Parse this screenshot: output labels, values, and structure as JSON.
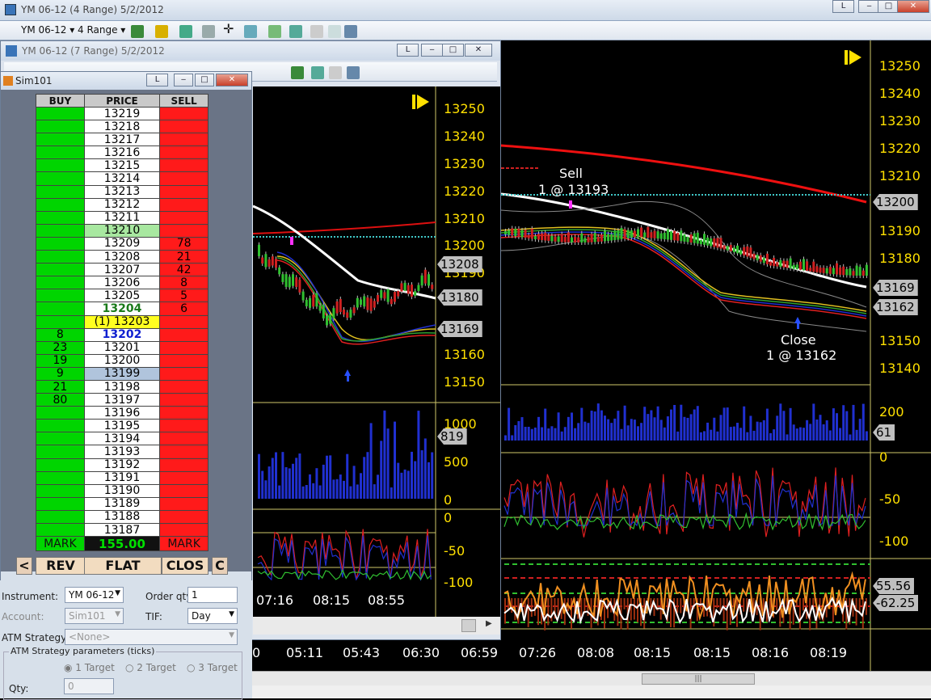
{
  "main_window": {
    "title": "YM 06-12 (4 Range)  5/2/2012",
    "l_btn": "L"
  },
  "toolbar": {
    "instrument": "YM 06-12",
    "interval": "4 Range"
  },
  "chart_back": {
    "title": "YM 06-12 (7 Range)  5/2/2012",
    "price_labels": [
      "13250",
      "13240",
      "13230",
      "13220",
      "13210",
      "13200",
      "13190",
      "13180",
      "13170",
      "13160",
      "13150"
    ],
    "price_tags": [
      "13208",
      "13180",
      "13169"
    ],
    "volume_labels": [
      "1000",
      "500",
      "0"
    ],
    "volume_tag": "819",
    "osc_labels": [
      "0",
      "-50",
      "-100"
    ],
    "time_labels": [
      "07:16",
      "08:15",
      "08:55"
    ],
    "l_btn": "L"
  },
  "chart_front": {
    "price_labels": [
      "13250",
      "13240",
      "13230",
      "13220",
      "13210",
      "13190",
      "13180",
      "13150",
      "13140"
    ],
    "price_tags": [
      "13200",
      "13169",
      "13162"
    ],
    "volume_labels": [
      "200"
    ],
    "volume_tag": "61",
    "osc_labels": [
      "0",
      "-50",
      "-100"
    ],
    "osc2_tags": [
      "55.56",
      "-62.25"
    ],
    "time_labels": [
      "05:11",
      "05:43",
      "06:30",
      "06:59",
      "07:26",
      "08:08",
      "08:15",
      "08:15",
      "08:16",
      "08:19"
    ],
    "time_partial": "0",
    "annotations": {
      "sell_line1": "Sell",
      "sell_line2": "1 @ 13193",
      "close_line1": "Close",
      "close_line2": "1 @ 13162"
    }
  },
  "dom": {
    "title": "Sim101",
    "l_btn": "L",
    "headers": {
      "buy": "BUY",
      "price": "PRICE",
      "sell": "SELL"
    },
    "rows": [
      {
        "buy": "",
        "price": "13219",
        "sell": ""
      },
      {
        "buy": "",
        "price": "13218",
        "sell": ""
      },
      {
        "buy": "",
        "price": "13217",
        "sell": ""
      },
      {
        "buy": "",
        "price": "13216",
        "sell": ""
      },
      {
        "buy": "",
        "price": "13215",
        "sell": ""
      },
      {
        "buy": "",
        "price": "13214",
        "sell": ""
      },
      {
        "buy": "",
        "price": "13213",
        "sell": ""
      },
      {
        "buy": "",
        "price": "13212",
        "sell": ""
      },
      {
        "buy": "",
        "price": "13211",
        "sell": ""
      },
      {
        "buy": "",
        "price": "13210",
        "sell": "",
        "hl": "green"
      },
      {
        "buy": "",
        "price": "13209",
        "sell": "78"
      },
      {
        "buy": "",
        "price": "13208",
        "sell": "21"
      },
      {
        "buy": "",
        "price": "13207",
        "sell": "42"
      },
      {
        "buy": "",
        "price": "13206",
        "sell": "8"
      },
      {
        "buy": "",
        "price": "13205",
        "sell": "5"
      },
      {
        "buy": "",
        "price": "13204",
        "sell": "6",
        "hl": "ask"
      },
      {
        "buy": "",
        "price": "(1) 13203",
        "sell": "",
        "hl": "pos"
      },
      {
        "buy": "8",
        "price": "13202",
        "sell": "",
        "hl": "bid"
      },
      {
        "buy": "23",
        "price": "13201",
        "sell": ""
      },
      {
        "buy": "19",
        "price": "13200",
        "sell": ""
      },
      {
        "buy": "9",
        "price": "13199",
        "sell": "",
        "hl": "blue"
      },
      {
        "buy": "21",
        "price": "13198",
        "sell": ""
      },
      {
        "buy": "80",
        "price": "13197",
        "sell": ""
      },
      {
        "buy": "",
        "price": "13196",
        "sell": ""
      },
      {
        "buy": "",
        "price": "13195",
        "sell": ""
      },
      {
        "buy": "",
        "price": "13194",
        "sell": ""
      },
      {
        "buy": "",
        "price": "13193",
        "sell": ""
      },
      {
        "buy": "",
        "price": "13192",
        "sell": ""
      },
      {
        "buy": "",
        "price": "13191",
        "sell": ""
      },
      {
        "buy": "",
        "price": "13190",
        "sell": ""
      },
      {
        "buy": "",
        "price": "13189",
        "sell": ""
      },
      {
        "buy": "",
        "price": "13188",
        "sell": ""
      },
      {
        "buy": "",
        "price": "13187",
        "sell": ""
      }
    ],
    "footer": {
      "buy_mark": "MARK",
      "pnl": "155.00",
      "sell_mark": "MARK"
    },
    "buttons": {
      "left": "<",
      "rev": "REV",
      "flat": "FLAT",
      "clos": "CLOS",
      "c": "C"
    },
    "form": {
      "instrument_label": "Instrument:",
      "instrument_value": "YM 06-12",
      "order_qty_label": "Order qty:",
      "order_qty_value": "1",
      "account_label": "Account:",
      "account_value": "Sim101",
      "tif_label": "TIF:",
      "tif_value": "Day",
      "atm_label": "ATM Strategy:",
      "atm_value": "<None>",
      "atm_params_label": "ATM Strategy parameters (ticks)",
      "target1": "1 Target",
      "target2": "2 Target",
      "target3": "3 Target",
      "qty_label": "Qty:",
      "qty_value": "0"
    }
  },
  "colors": {
    "axis": "#ffe000",
    "buy": "#00d500",
    "sell": "#ff1a1a"
  }
}
